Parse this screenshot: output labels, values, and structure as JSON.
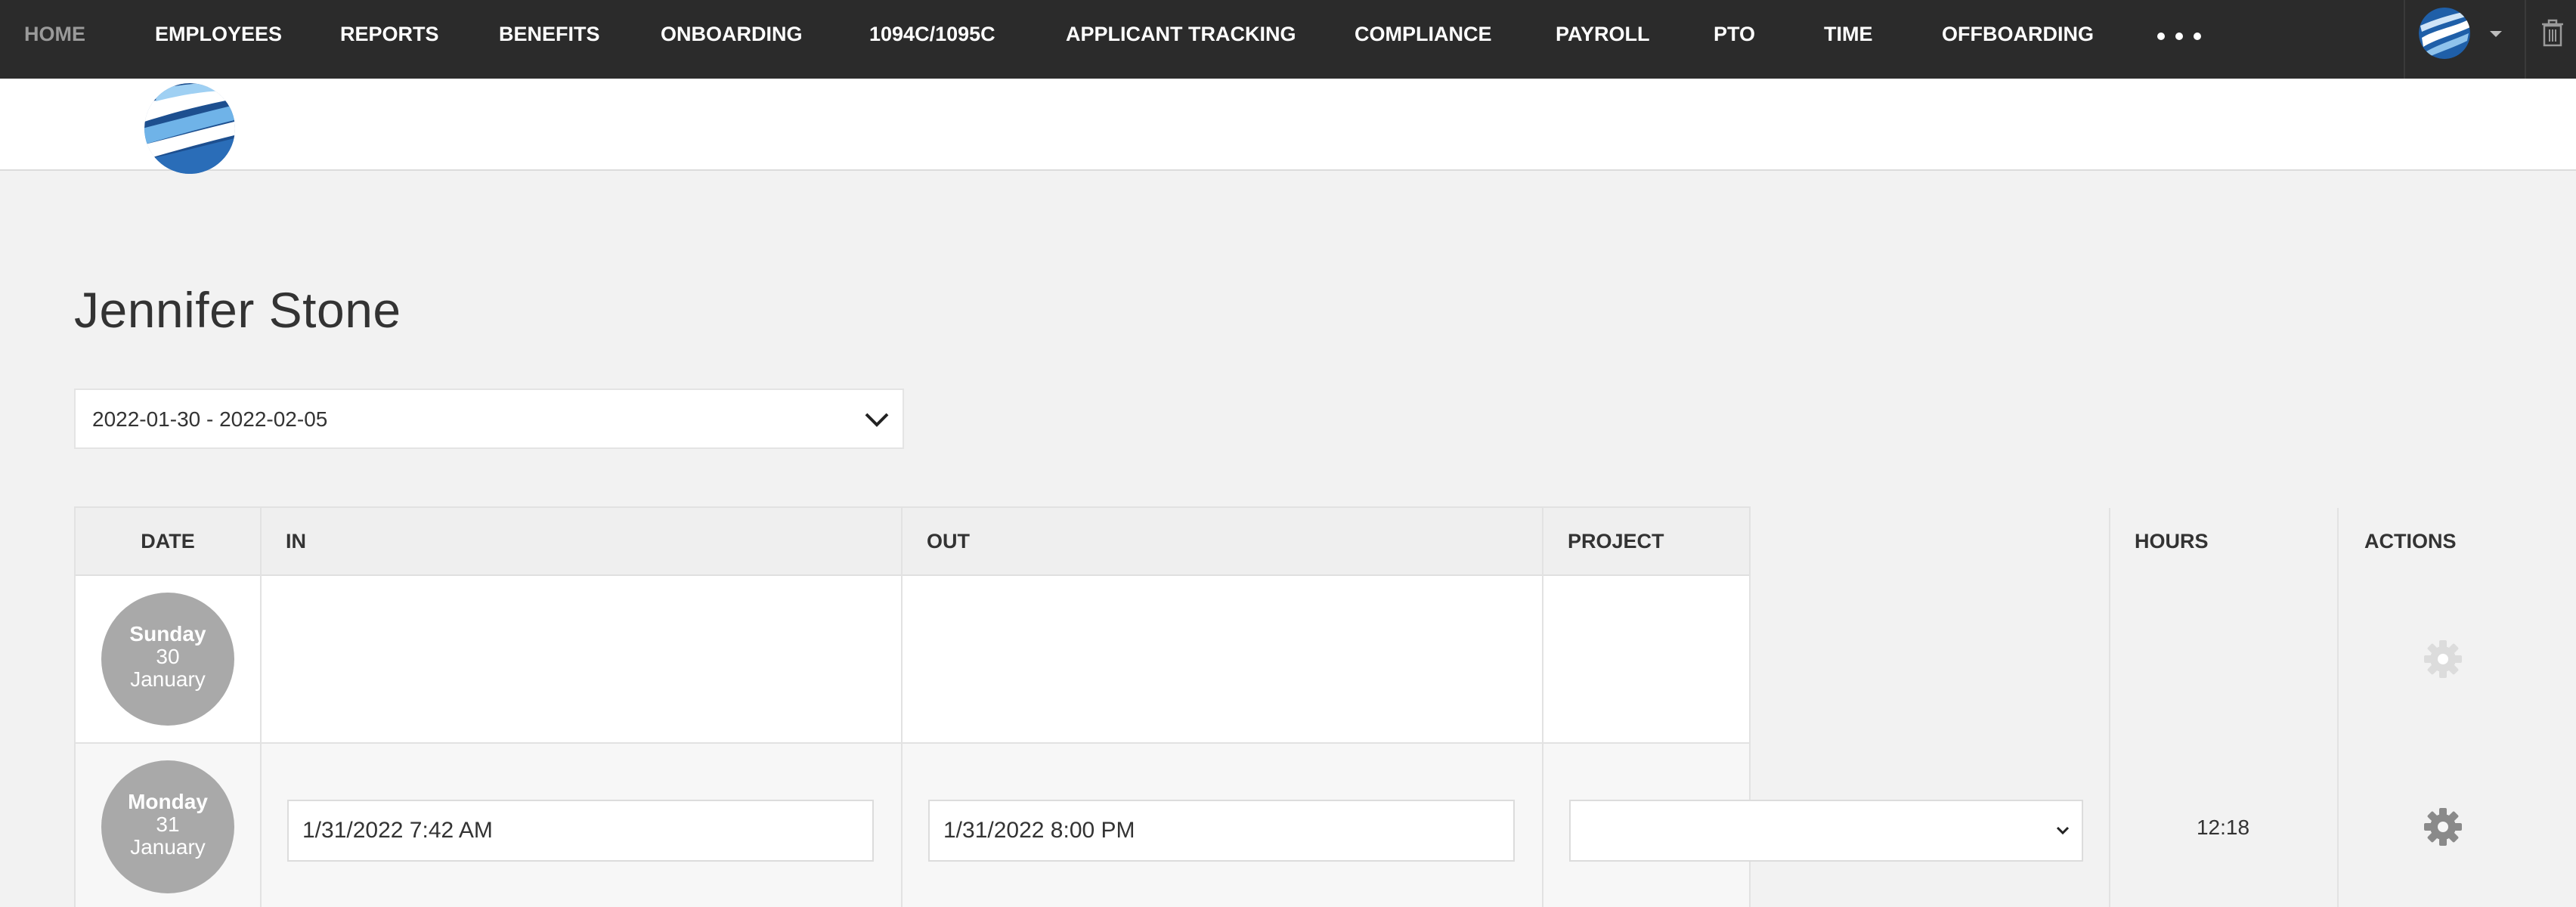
{
  "nav": {
    "items": [
      "HOME",
      "EMPLOYEES",
      "REPORTS",
      "BENEFITS",
      "ONBOARDING",
      "1094C/1095C",
      "APPLICANT TRACKING",
      "COMPLIANCE",
      "PAYROLL",
      "PTO",
      "TIME",
      "OFFBOARDING"
    ],
    "more_icon": "ellipsis-icon",
    "active_color": "#9a9a9a",
    "background": "#2b2b2b"
  },
  "employee": {
    "name": "Jennifer Stone"
  },
  "period": {
    "selected": "2022-01-30 - 2022-02-05"
  },
  "table": {
    "headers": {
      "date": "DATE",
      "in": "IN",
      "out": "OUT",
      "project": "PROJECT",
      "hours": "HOURS",
      "actions": "ACTIONS"
    },
    "rows": [
      {
        "weekday": "Sunday",
        "day": "30",
        "month": "January",
        "in": "",
        "out": "",
        "project": "",
        "hours": "",
        "action_icon": "gear-icon-disabled"
      },
      {
        "weekday": "Monday",
        "day": "31",
        "month": "January",
        "in": "1/31/2022 7:42 AM",
        "out": "1/31/2022 8:00 PM",
        "project": "",
        "hours": "12:18",
        "action_icon": "gear-icon"
      }
    ]
  }
}
